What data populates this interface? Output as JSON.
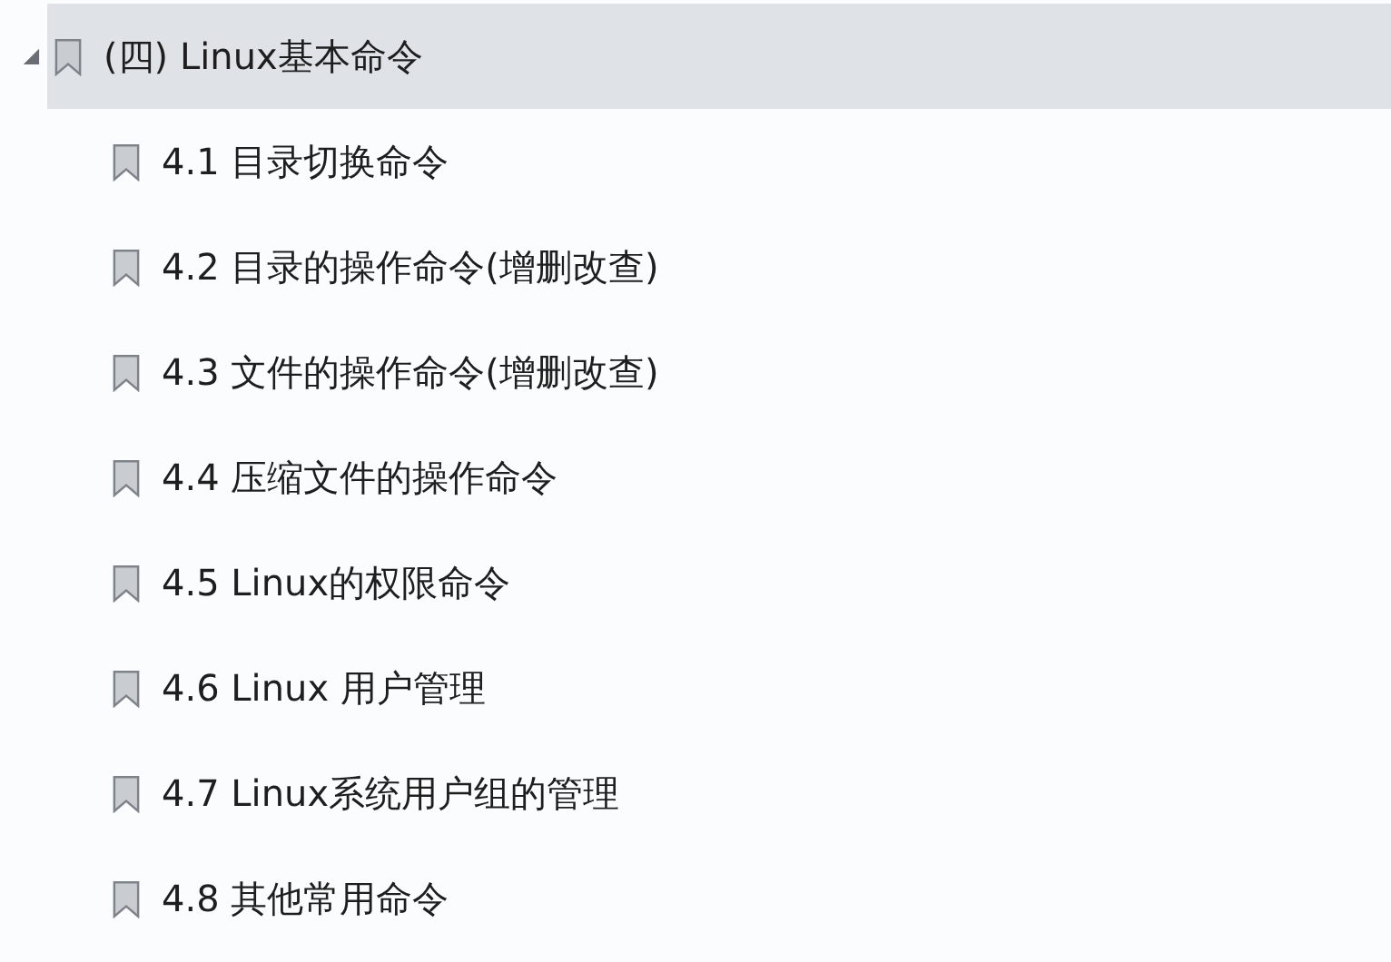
{
  "outline": [
    {
      "label": "(四) Linux基本命令",
      "selected": true,
      "expanded": true,
      "children": [
        {
          "label": "4.1 目录切换命令",
          "selected": false
        },
        {
          "label": "4.2 目录的操作命令(增删改查)",
          "selected": false
        },
        {
          "label": "4.3 文件的操作命令(增删改查)",
          "selected": false
        },
        {
          "label": "4.4 压缩文件的操作命令",
          "selected": false
        },
        {
          "label": "4.5 Linux的权限命令",
          "selected": false
        },
        {
          "label": "4.6 Linux 用户管理",
          "selected": false
        },
        {
          "label": "4.7 Linux系统用户组的管理",
          "selected": false
        },
        {
          "label": "4.8 其他常用命令",
          "selected": false
        }
      ]
    }
  ]
}
